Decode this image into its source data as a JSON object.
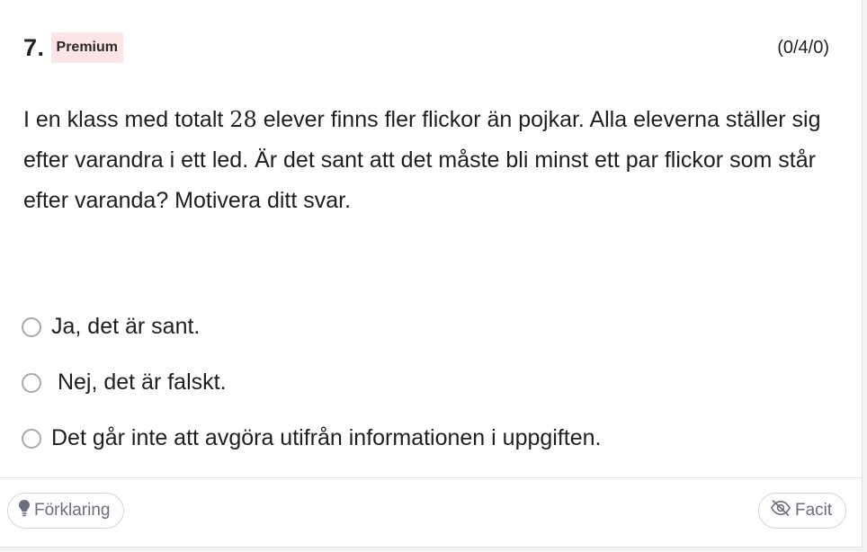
{
  "question": {
    "number": "7.",
    "badge": "Premium",
    "points": "(0/4/0)",
    "text_before": "I en klass med totalt ",
    "text_number": "28",
    "text_after": " elever finns fler flickor än pojkar. Alla eleverna ställer sig efter varandra i ett led. Är det sant att det måste bli minst ett par flickor som står efter varanda? Motivera ditt svar."
  },
  "options": [
    {
      "label": "Ja, det är sant."
    },
    {
      "label": " Nej, det är falskt."
    },
    {
      "label": "Det går inte att avgöra utifrån informationen i uppgiften."
    }
  ],
  "footer": {
    "explain_label": "Förklaring",
    "explain_icon": "lightbulb-icon",
    "facit_label": "Facit",
    "facit_icon": "eye-off-icon"
  }
}
